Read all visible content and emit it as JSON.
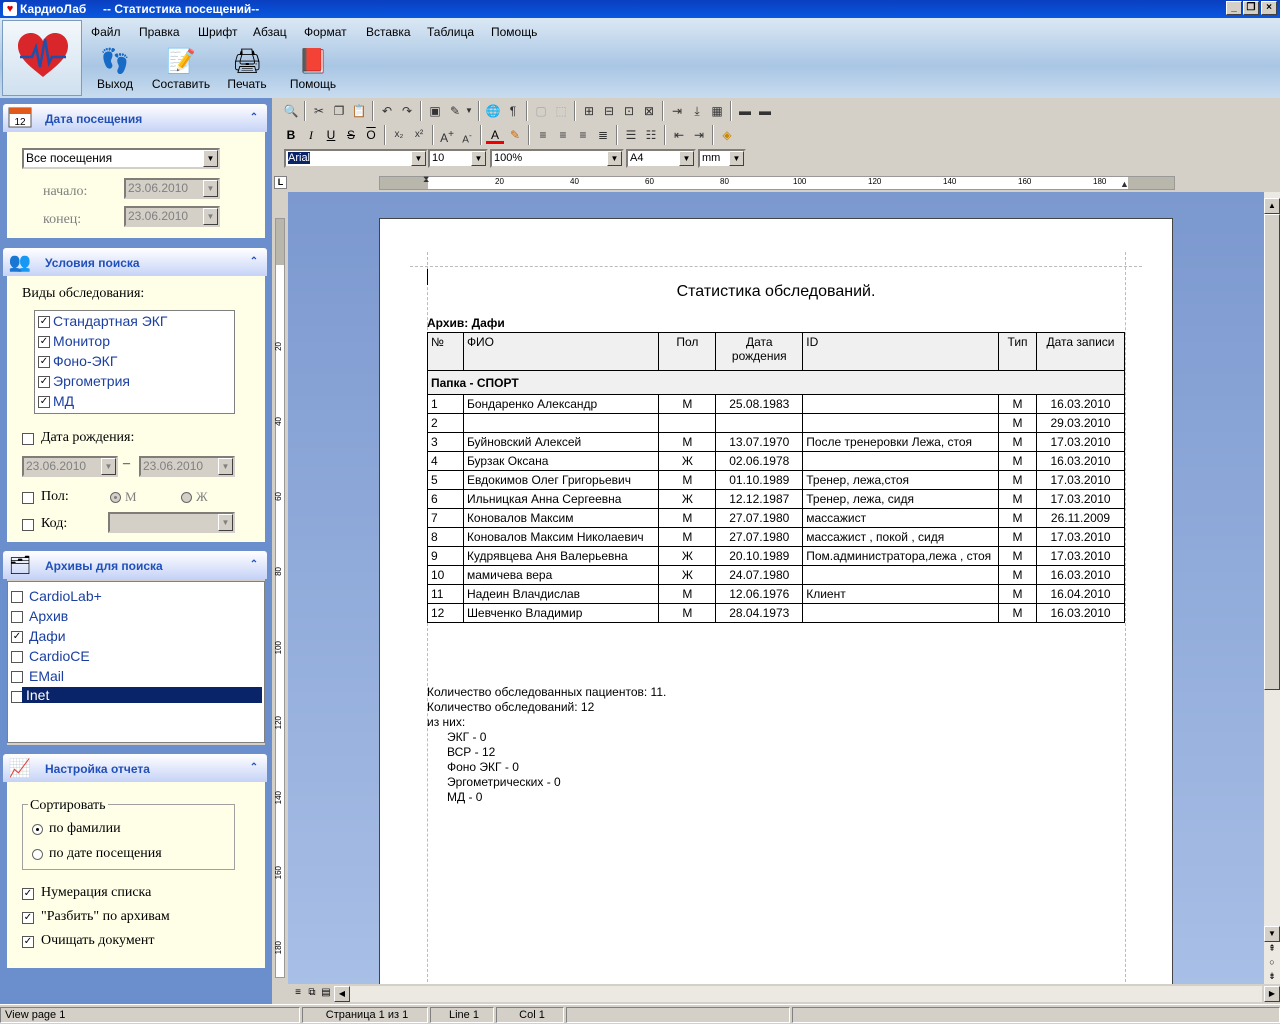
{
  "window": {
    "app_title": "КардиоЛаб",
    "doc_title": "-- Статистика посещений--",
    "min_label": "_",
    "max_label": "❐",
    "close_label": "×"
  },
  "menu": [
    "Файл",
    "Правка",
    "Шрифт",
    "Абзац",
    "Формат",
    "Вставка",
    "Таблица",
    "Помощь"
  ],
  "toolbar_big": [
    {
      "label": "Выход",
      "icon": "exit-footprints-icon",
      "glyph": "👣"
    },
    {
      "label": "Составить",
      "icon": "compose-notepad-icon",
      "glyph": "📝"
    },
    {
      "label": "Печать",
      "icon": "printer-icon",
      "glyph": "🖨"
    },
    {
      "label": "Помощь",
      "icon": "help-book-icon",
      "glyph": "📕"
    }
  ],
  "panels": {
    "visit_date": {
      "title": "Дата посещения",
      "icon_text": "12",
      "mode_value": "Все посещения",
      "start_label": "начало:",
      "start_value": "23.06.2010",
      "end_label": "конец:",
      "end_value": "23.06.2010"
    },
    "search_conditions": {
      "title": "Условия поиска",
      "exam_types_label": "Виды обследования:",
      "exam_types": [
        {
          "label": "Стандартная ЭКГ",
          "checked": true
        },
        {
          "label": "Монитор",
          "checked": true
        },
        {
          "label": "Фоно-ЭКГ",
          "checked": true
        },
        {
          "label": "Эргометрия",
          "checked": true
        },
        {
          "label": "МД",
          "checked": true
        }
      ],
      "birth_date_label": "Дата рождения:",
      "birth_from": "23.06.2010",
      "birth_dash": "–",
      "birth_to": "23.06.2010",
      "sex_label": "Пол:",
      "sex_m": "М",
      "sex_f": "Ж",
      "code_label": "Код:"
    },
    "archives": {
      "title": "Архивы для поиска",
      "items": [
        {
          "label": "CardioLab+",
          "checked": false,
          "selected": false
        },
        {
          "label": "Архив",
          "checked": false,
          "selected": false
        },
        {
          "label": "Дафи",
          "checked": true,
          "selected": false
        },
        {
          "label": "CardioCE",
          "checked": false,
          "selected": false
        },
        {
          "label": "EMail",
          "checked": false,
          "selected": false
        },
        {
          "label": "Inet",
          "checked": false,
          "selected": true
        }
      ]
    },
    "report_settings": {
      "title": "Настройка отчета",
      "sort_label": "Сортировать",
      "sort_by_name": "по фамилии",
      "sort_by_date": "по дате посещения",
      "numbering": "Нумерация списка",
      "split_archives": "\"Разбить\" по архивам",
      "clear_doc": "Очищать документ"
    }
  },
  "format_bar": {
    "font": "Arial",
    "size": "10",
    "zoom": "100%",
    "paper": "A4",
    "unit": "mm"
  },
  "ruler": {
    "h_ticks": [
      "20",
      "40",
      "60",
      "80",
      "100",
      "120",
      "140",
      "160",
      "180"
    ],
    "v_ticks": [
      "20",
      "40",
      "60",
      "80",
      "100",
      "120",
      "140",
      "160",
      "180"
    ]
  },
  "report": {
    "title": "Статистика обследований.",
    "archive_line": "Архив:  Дафи",
    "columns": [
      "№",
      "ФИО",
      "Пол",
      "Дата рождения",
      "ID",
      "Тип",
      "Дата записи"
    ],
    "folder": "Папка - СПОРТ",
    "rows": [
      {
        "n": "1",
        "name": "Бондаренко Александр",
        "sex": "М",
        "dob": "25.08.1983",
        "id": "",
        "type": "М",
        "date": "16.03.2010"
      },
      {
        "n": "2",
        "name": "",
        "sex": "",
        "dob": "",
        "id": "",
        "type": "М",
        "date": "29.03.2010"
      },
      {
        "n": "3",
        "name": "Буйновский Алексей",
        "sex": "М",
        "dob": "13.07.1970",
        "id": "После тренеровки Лежа, стоя",
        "type": "М",
        "date": "17.03.2010"
      },
      {
        "n": "4",
        "name": "Бурзак Оксана",
        "sex": "Ж",
        "dob": "02.06.1978",
        "id": "",
        "type": "М",
        "date": "16.03.2010"
      },
      {
        "n": "5",
        "name": "Евдокимов Олег Григорьевич",
        "sex": "М",
        "dob": "01.10.1989",
        "id": "Тренер, лежа,стоя",
        "type": "М",
        "date": "17.03.2010"
      },
      {
        "n": "6",
        "name": "Ильницкая Анна Сергеевна",
        "sex": "Ж",
        "dob": "12.12.1987",
        "id": "Тренер, лежа, сидя",
        "type": "М",
        "date": "17.03.2010"
      },
      {
        "n": "7",
        "name": "Коновалов Максим",
        "sex": "М",
        "dob": "27.07.1980",
        "id": "массажист",
        "type": "М",
        "date": "26.11.2009"
      },
      {
        "n": "8",
        "name": "Коновалов Максим Николаевич",
        "sex": "М",
        "dob": "27.07.1980",
        "id": "массажист , покой , сидя",
        "type": "М",
        "date": "17.03.2010"
      },
      {
        "n": "9",
        "name": "Кудрявцева Аня Валерьевна",
        "sex": "Ж",
        "dob": "20.10.1989",
        "id": "Пом.администратора,лежа , стоя",
        "type": "М",
        "date": "17.03.2010"
      },
      {
        "n": "10",
        "name": "мамичева вера",
        "sex": "Ж",
        "dob": "24.07.1980",
        "id": "",
        "type": "М",
        "date": "16.03.2010"
      },
      {
        "n": "11",
        "name": "Надеин Влачдислав",
        "sex": "М",
        "dob": "12.06.1976",
        "id": "Клиент",
        "type": "М",
        "date": "16.04.2010"
      },
      {
        "n": "12",
        "name": "Шевченко Владимир",
        "sex": "М",
        "dob": "28.04.1973",
        "id": "",
        "type": "М",
        "date": "16.03.2010"
      }
    ],
    "summary": [
      "Количество обследованных пациентов: 11.",
      "Количество обследований: 12",
      "из них:",
      "ЭКГ  -  0",
      "ВСР  -  12",
      "Фоно ЭКГ  -  0",
      "Эргометрических  -  0",
      "МД  -  0"
    ]
  },
  "status": {
    "view": "View page 1",
    "page": "Страница 1 из 1",
    "line": "Line 1",
    "col": "Col 1"
  }
}
